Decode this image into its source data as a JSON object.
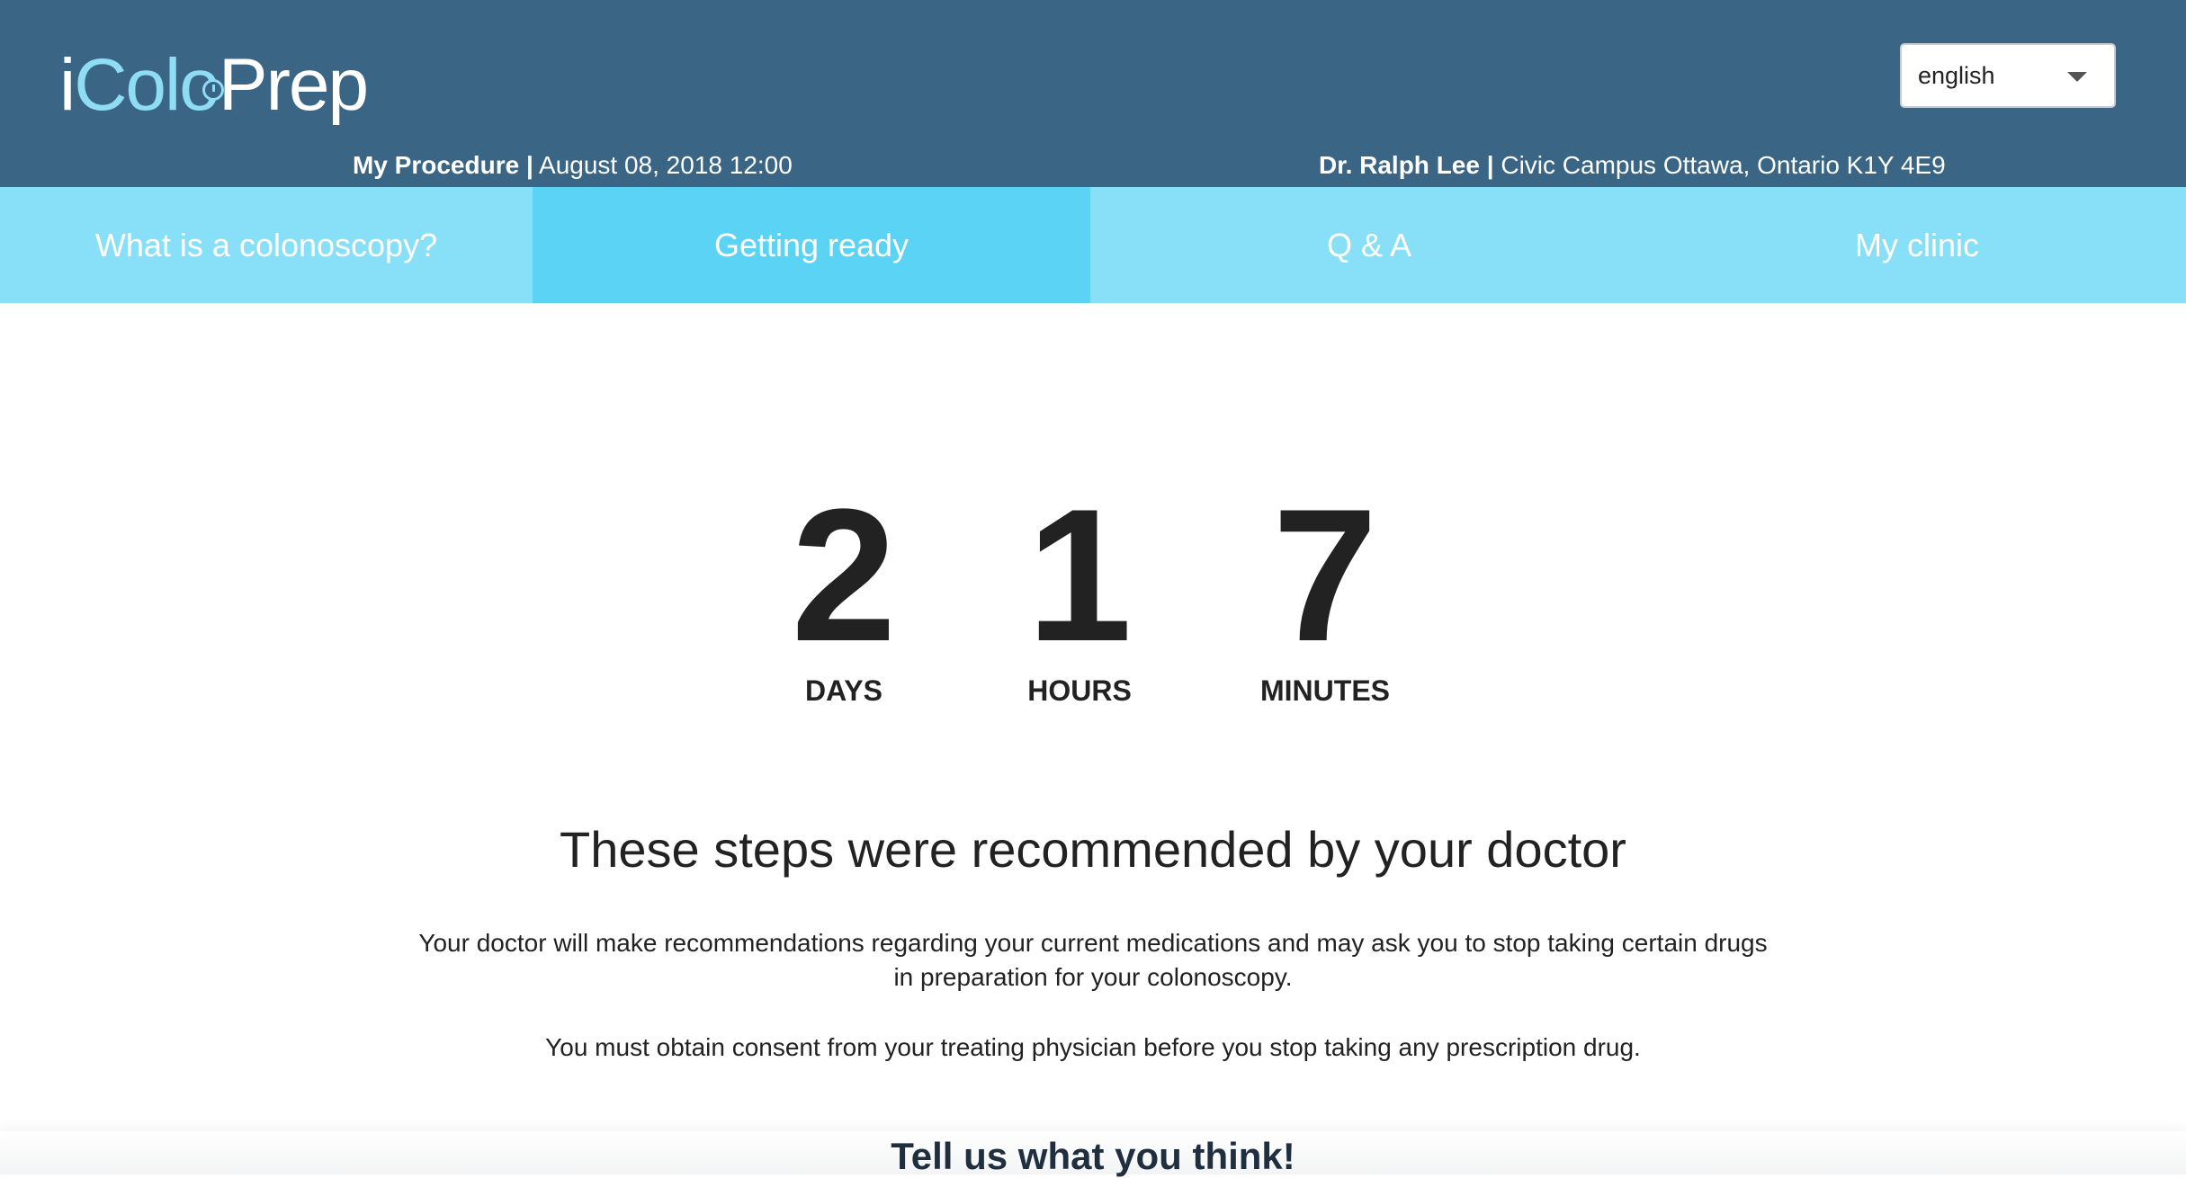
{
  "header": {
    "logo": {
      "i": "i",
      "colo": "Colo",
      "prep": "Prep"
    },
    "language": {
      "selected": "english"
    },
    "procedure": {
      "label": "My Procedure |",
      "datetime": " August 08, 2018 12:00"
    },
    "doctor": {
      "name": "Dr. Ralph Lee |",
      "location": " Civic Campus Ottawa, Ontario K1Y 4E9"
    }
  },
  "nav": {
    "tabs": [
      {
        "label": "What is a colonoscopy?",
        "active": false
      },
      {
        "label": "Getting ready",
        "active": true
      },
      {
        "label": "Q & A",
        "active": false
      },
      {
        "label": "My clinic",
        "active": false
      }
    ]
  },
  "countdown": {
    "days": {
      "value": "2",
      "label": "DAYS"
    },
    "hours": {
      "value": "1",
      "label": "HOURS"
    },
    "minutes": {
      "value": "7",
      "label": "MINUTES"
    }
  },
  "content": {
    "heading": "These steps were recommended by your doctor",
    "paragraph1": "Your doctor will make recommendations regarding your current medications and may ask you to stop taking certain drugs in preparation for your colonoscopy.",
    "paragraph2": "You must obtain consent from your treating physician before you stop taking any prescription drug."
  },
  "feedback": {
    "title": "Tell us what you think!"
  },
  "colors": {
    "header_bg": "#3a6585",
    "nav_bg": "#88e0f8",
    "nav_active_bg": "#5ad3f5",
    "logo_accent": "#8fdcf5"
  },
  "icons": {
    "logo_clock": "clock-icon",
    "language_caret": "caret-down-icon"
  }
}
